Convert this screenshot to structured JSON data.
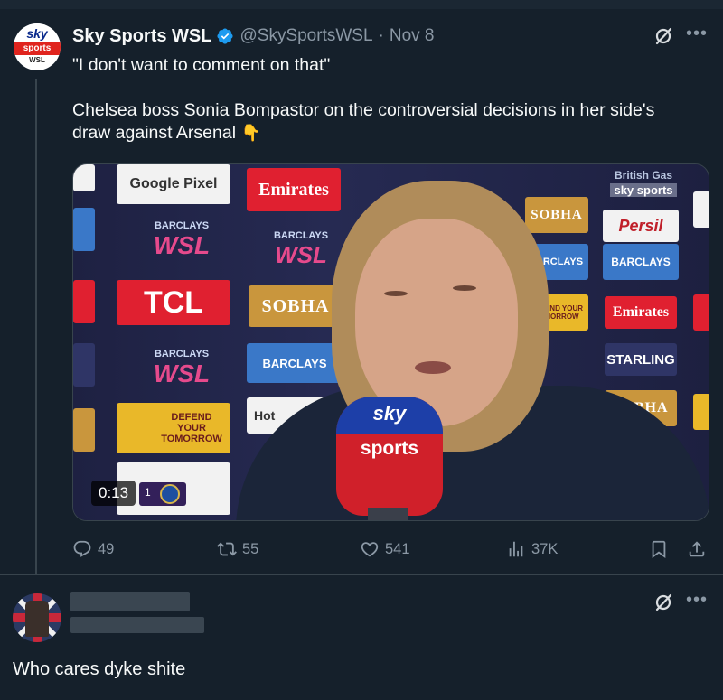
{
  "tweet": {
    "display_name": "Sky Sports WSL",
    "handle": "@SkySportsWSL",
    "separator": "·",
    "date": "Nov 8",
    "text_line1": "\"I don't want to comment on that\"",
    "text_line2": "Chelsea boss Sonia Bompastor on the controversial decisions in her side's",
    "text_line3": "draw against Arsenal",
    "emoji": "👇",
    "avatar": {
      "word_top": "sky",
      "word_mid": "sports",
      "word_bottom": "WSL"
    },
    "media": {
      "timestamp": "0:13",
      "score": "1",
      "mic_top": "sky",
      "mic_bottom": "sports",
      "boards": {
        "google": "Google Pixel",
        "emirates": "Emirates",
        "barclays": "BARCLAYS",
        "wsl": "WSL",
        "tcl": "TCL",
        "sobha": "SOBHA",
        "defend1": "DEFEND YOUR TOMORROW",
        "persil": "Persil",
        "starling": "STARLING",
        "british": "British Gas",
        "skysports": "sky sports",
        "hotel": "Hot"
      }
    },
    "stats": {
      "replies": "49",
      "reposts": "55",
      "likes": "541",
      "views": "37K"
    }
  },
  "reply": {
    "text": "Who cares dyke shite"
  },
  "colors": {
    "background": "#15202b",
    "text": "#f7f9f9",
    "muted": "#8b98a5",
    "verified": "#1d9bf0",
    "border": "#38444d"
  },
  "icons": [
    "verified-badge-icon",
    "grok-icon",
    "more-icon",
    "reply-icon",
    "repost-icon",
    "like-icon",
    "views-icon",
    "bookmark-icon",
    "share-icon"
  ]
}
